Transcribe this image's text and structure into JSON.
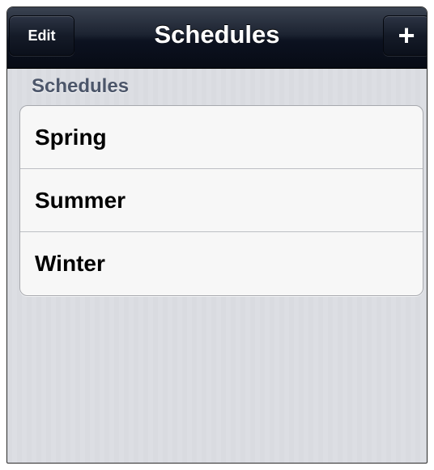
{
  "navbar": {
    "title": "Schedules",
    "edit_label": "Edit",
    "add_label": "+"
  },
  "section": {
    "header": "Schedules"
  },
  "schedules": [
    {
      "label": "Spring"
    },
    {
      "label": "Summer"
    },
    {
      "label": "Winter"
    }
  ],
  "colors": {
    "navbar": "#0c1220",
    "background": "#dadce1",
    "section_header": "#4c566a",
    "cell_background": "#f7f7f7"
  },
  "icons": {
    "add": "plus-icon"
  }
}
